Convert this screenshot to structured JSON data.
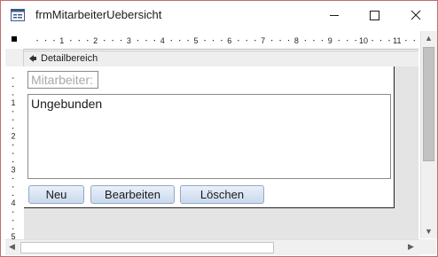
{
  "window": {
    "title": "frmMitarbeiterUebersicht",
    "minimize_icon": "minimize-icon",
    "maximize_icon": "maximize-icon",
    "close_icon": "close-icon"
  },
  "ruler": {
    "top_numbers": [
      "1",
      "2",
      "3",
      "4",
      "5",
      "6",
      "7",
      "8",
      "9",
      "10",
      "11"
    ],
    "left_numbers": [
      "1",
      "2",
      "3",
      "4",
      "5"
    ]
  },
  "section": {
    "label": "Detailbereich",
    "icon": "section-arrow-icon"
  },
  "form": {
    "label": "Mitarbeiter:",
    "subform_text": "Ungebunden",
    "buttons": {
      "new": "Neu",
      "edit": "Bearbeiten",
      "delete": "Löschen"
    }
  },
  "colors": {
    "window_border": "#c26c6c",
    "button_border": "#94a9c6",
    "button_fill": "#cad9ee"
  }
}
